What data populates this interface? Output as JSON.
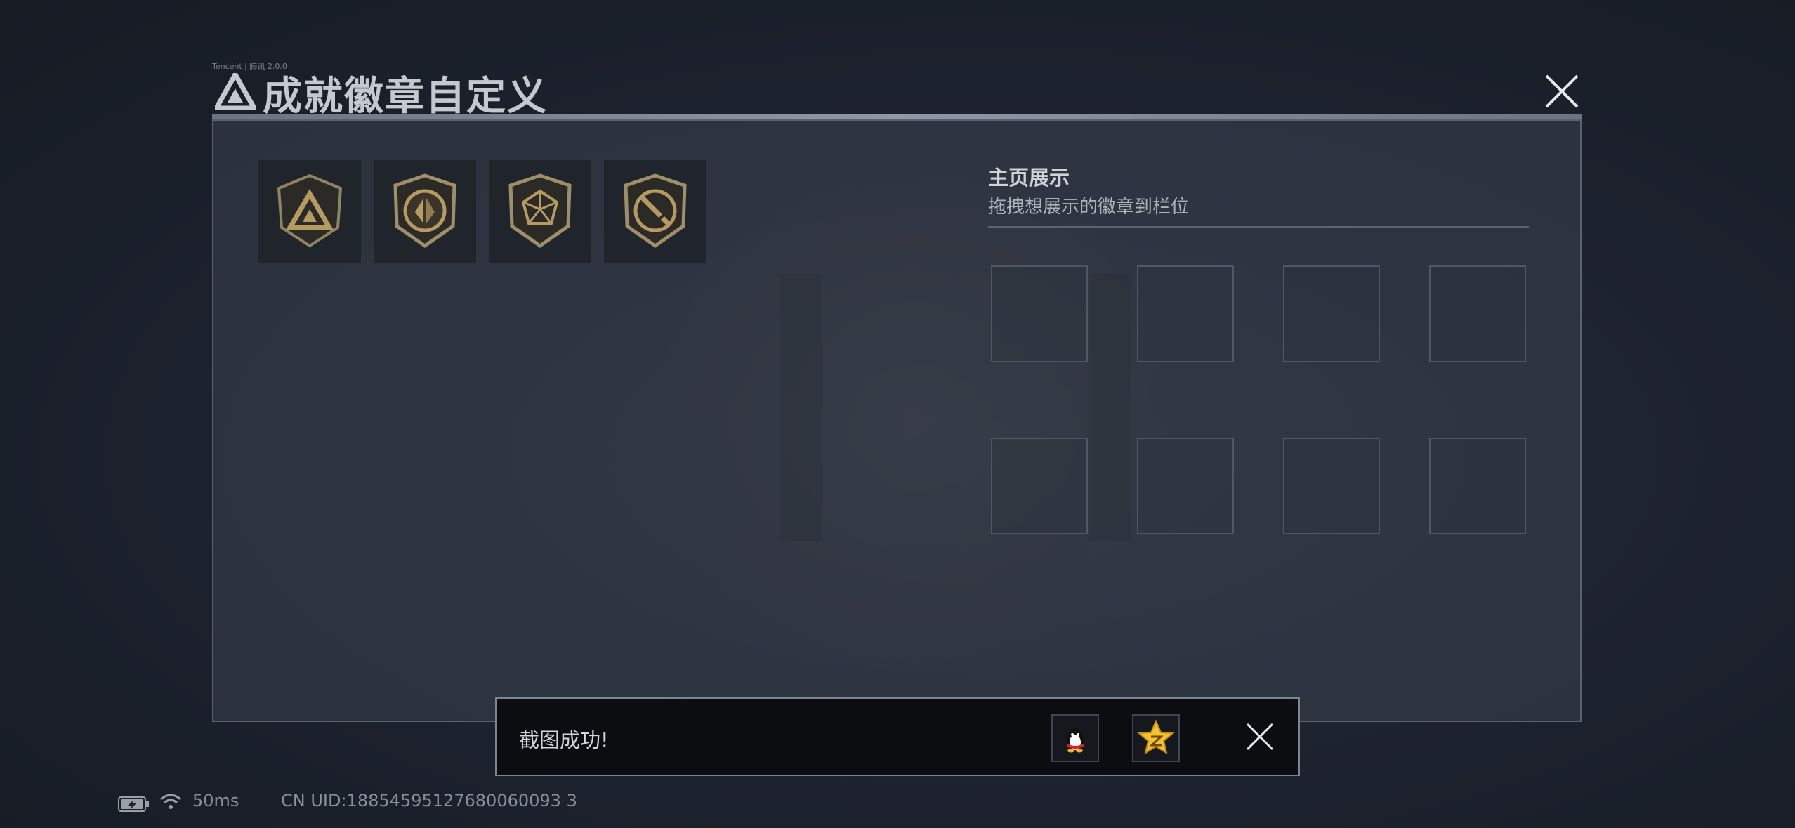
{
  "header": {
    "small_caption": "Tencent | 腾讯 2.0.0",
    "title": "成就徽章自定义"
  },
  "badges": [
    {
      "name": "triangle-emblem-badge"
    },
    {
      "name": "wing-emblem-badge"
    },
    {
      "name": "gem-emblem-badge"
    },
    {
      "name": "sword-ring-badge"
    }
  ],
  "home_display": {
    "title": "主页展示",
    "subtitle": "拖拽想展示的徽章到栏位",
    "slot_count": 8
  },
  "toast": {
    "message": "截图成功!",
    "share_qq_icon": "qq-penguin-icon",
    "share_qzone_icon": "qzone-star-icon"
  },
  "status_bar": {
    "ping": "50ms",
    "uid": "CN UID:18854595127680060093 3"
  },
  "colors": {
    "accent_gold": "#b59b62",
    "qzone_yellow": "#f2c230"
  }
}
